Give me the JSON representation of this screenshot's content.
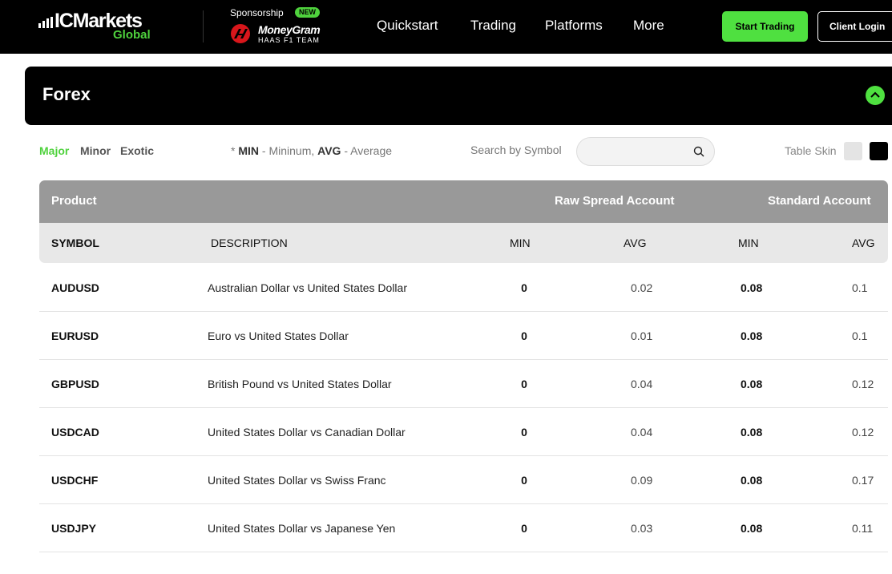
{
  "header": {
    "brand": "ICMarkets",
    "brand_sub": "Global",
    "sponsorship_label": "Sponsorship",
    "new_badge": "NEW",
    "sponsor_name": "MoneyGram",
    "sponsor_team": "HAAS F1 TEAM",
    "nav": [
      "Quickstart",
      "Trading",
      "Platforms",
      "More"
    ],
    "start_trading": "Start Trading",
    "client_login": "Client Login",
    "accent_color": "#4fe040"
  },
  "section": {
    "title": "Forex",
    "collapse_icon": "chevron-up-icon"
  },
  "filters": {
    "tabs": [
      "Major",
      "Minor",
      "Exotic"
    ],
    "active_tab": "Major",
    "legend_prefix": "* ",
    "legend_min_key": "MIN",
    "legend_min_text": " - Mininum, ",
    "legend_avg_key": "AVG",
    "legend_avg_text": " - Average",
    "search_label": "Search by Symbol",
    "search_value": "",
    "table_skin_label": "Table Skin"
  },
  "table": {
    "group_headers": {
      "product": "Product",
      "raw": "Raw Spread Account",
      "standard": "Standard Account"
    },
    "columns": {
      "symbol": "SYMBOL",
      "description": "DESCRIPTION",
      "raw_min": "MIN",
      "raw_avg": "AVG",
      "std_min": "MIN",
      "std_avg": "AVG"
    },
    "rows": [
      {
        "symbol": "AUDUSD",
        "description": "Australian Dollar vs United States Dollar",
        "raw_min": "0",
        "raw_avg": "0.02",
        "std_min": "0.08",
        "std_avg": "0.1"
      },
      {
        "symbol": "EURUSD",
        "description": "Euro vs United States Dollar",
        "raw_min": "0",
        "raw_avg": "0.01",
        "std_min": "0.08",
        "std_avg": "0.1"
      },
      {
        "symbol": "GBPUSD",
        "description": "British Pound vs United States Dollar",
        "raw_min": "0",
        "raw_avg": "0.04",
        "std_min": "0.08",
        "std_avg": "0.12"
      },
      {
        "symbol": "USDCAD",
        "description": "United States Dollar vs Canadian Dollar",
        "raw_min": "0",
        "raw_avg": "0.04",
        "std_min": "0.08",
        "std_avg": "0.12"
      },
      {
        "symbol": "USDCHF",
        "description": "United States Dollar vs Swiss Franc",
        "raw_min": "0",
        "raw_avg": "0.09",
        "std_min": "0.08",
        "std_avg": "0.17"
      },
      {
        "symbol": "USDJPY",
        "description": "United States Dollar vs Japanese Yen",
        "raw_min": "0",
        "raw_avg": "0.03",
        "std_min": "0.08",
        "std_avg": "0.11"
      }
    ]
  }
}
